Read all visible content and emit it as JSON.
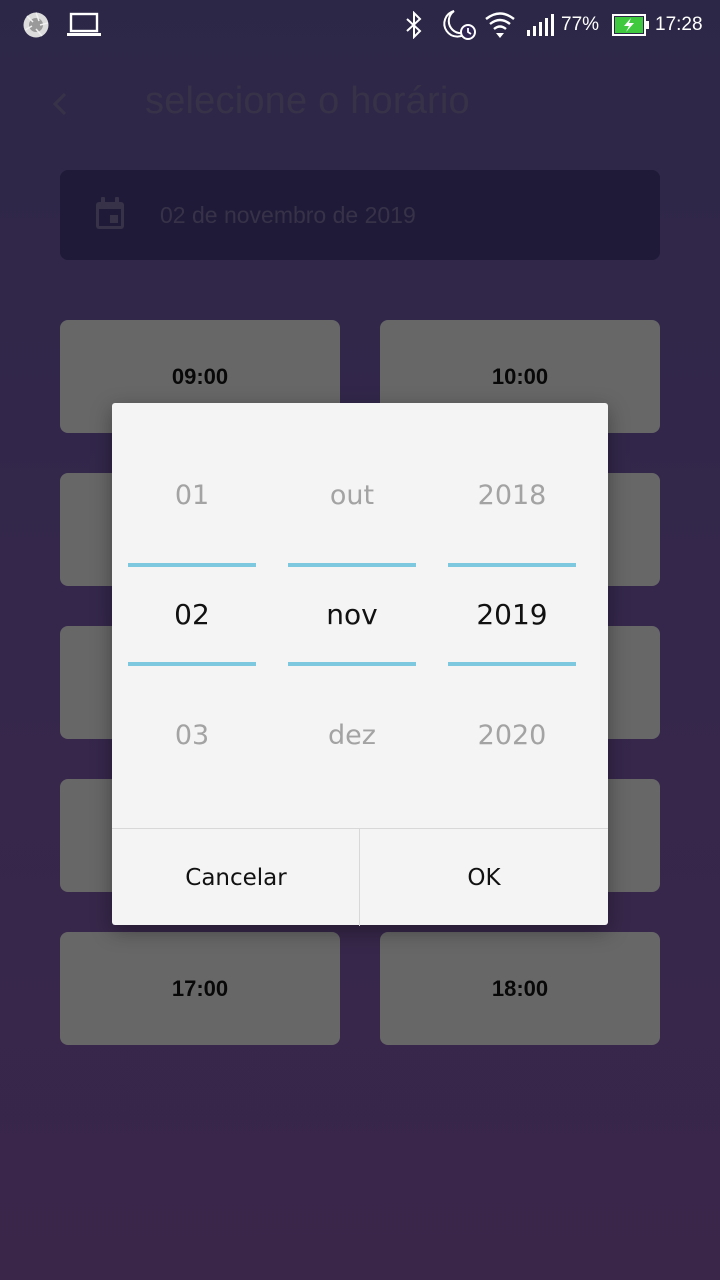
{
  "status_bar": {
    "battery_percent": "77%",
    "time": "17:28",
    "icons": [
      "aperture-icon",
      "laptop-icon",
      "bluetooth-icon",
      "moon-alarm-icon",
      "wifi-icon",
      "signal-icon",
      "battery-charging-icon"
    ]
  },
  "header": {
    "back_icon": "chevron-left-icon",
    "title": "selecione o horário"
  },
  "date_field": {
    "icon": "calendar-icon",
    "value": "02 de novembro de 2019"
  },
  "time_slots": [
    "09:00",
    "10:00",
    "",
    "",
    "",
    "",
    "",
    "",
    "17:00",
    "18:00"
  ],
  "date_picker": {
    "day": {
      "prev": "01",
      "selected": "02",
      "next": "03"
    },
    "month": {
      "prev": "out",
      "selected": "nov",
      "next": "dez"
    },
    "year": {
      "prev": "2018",
      "selected": "2019",
      "next": "2020"
    },
    "cancel_label": "Cancelar",
    "ok_label": "OK",
    "accent_color": "#7ec8df"
  }
}
